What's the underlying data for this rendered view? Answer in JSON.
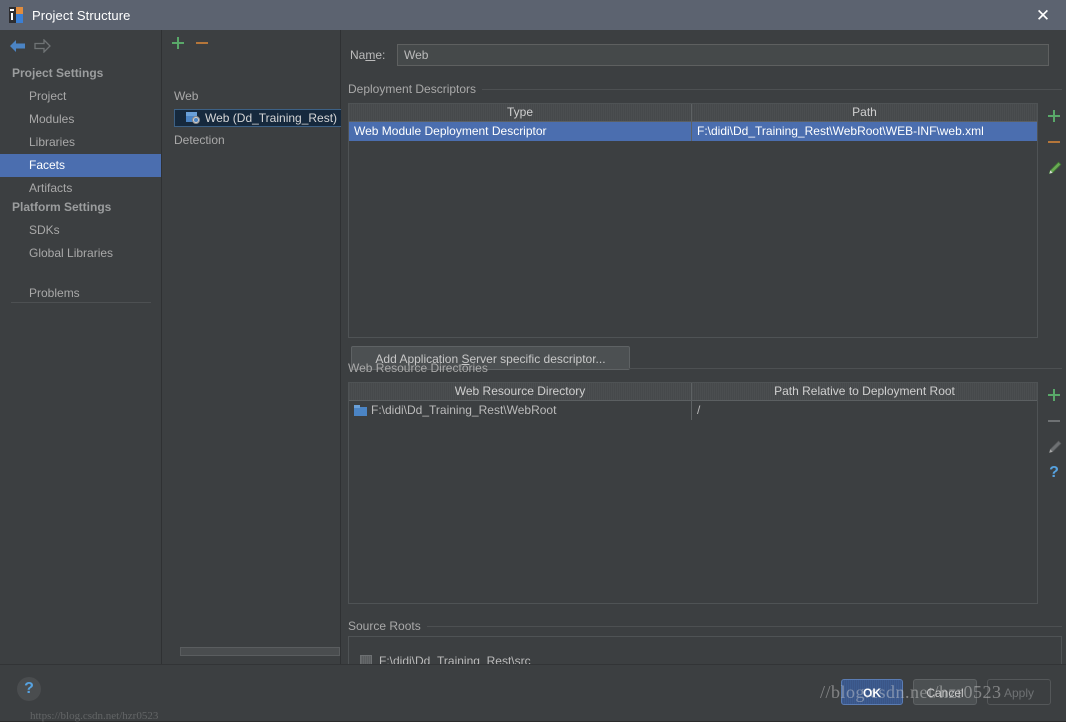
{
  "window": {
    "title": "Project Structure",
    "icon": "intellij-idea-icon",
    "close_label": "✕"
  },
  "nav": {
    "back_icon": "arrow-left-icon",
    "forward_icon": "arrow-right-icon"
  },
  "sidebar": {
    "groups": [
      {
        "label": "Project Settings"
      },
      {
        "label": "Platform Settings"
      }
    ],
    "items": [
      {
        "label": "Project",
        "selected": false
      },
      {
        "label": "Modules",
        "selected": false
      },
      {
        "label": "Libraries",
        "selected": false
      },
      {
        "label": "Facets",
        "selected": true
      },
      {
        "label": "Artifacts",
        "selected": false
      },
      {
        "label": "SDKs",
        "selected": false
      },
      {
        "label": "Global Libraries",
        "selected": false
      },
      {
        "label": "Problems",
        "selected": false
      }
    ]
  },
  "tree_panel": {
    "toolbar": {
      "add_icon": "plus-icon",
      "remove_icon": "minus-icon",
      "add_color": "#59a869",
      "remove_color": "#b5763a"
    },
    "group_web": "Web",
    "group_detection": "Detection",
    "selected_node": "Web (Dd_Training_Rest)",
    "node_icon": "web-facet-icon"
  },
  "content": {
    "name": {
      "label_before": "Na",
      "label_accel": "m",
      "label_after": "e:",
      "value": "Web"
    },
    "deployment_descriptors": {
      "section_label": "Deployment Descriptors",
      "columns": [
        "Type",
        "Path"
      ],
      "rows": [
        {
          "type": "Web Module Deployment Descriptor",
          "path": "F:\\didi\\Dd_Training_Rest\\WebRoot\\WEB-INF\\web.xml",
          "selected": true
        }
      ],
      "toolbar": [
        {
          "name": "add-descriptor-icon",
          "icon": "plus-icon",
          "color": "#59a869",
          "enabled": true
        },
        {
          "name": "remove-descriptor-icon",
          "icon": "minus-icon",
          "color": "#b5763a",
          "enabled": true
        },
        {
          "name": "edit-descriptor-icon",
          "icon": "pencil-icon",
          "color": "#59a869",
          "enabled": true
        }
      ]
    },
    "add_descriptor_button": {
      "text_before": "Add Application ",
      "text_accel": "S",
      "text_after": "erver specific descriptor..."
    },
    "web_resource_directories": {
      "section_label": "Web Resource Directories",
      "columns": [
        "Web Resource Directory",
        "Path Relative to Deployment Root"
      ],
      "rows": [
        {
          "directory": "F:\\didi\\Dd_Training_Rest\\WebRoot",
          "relative_path": "/",
          "icon": "folder-icon",
          "selected": false
        }
      ],
      "toolbar": [
        {
          "name": "add-web-resource-icon",
          "icon": "plus-icon",
          "color": "#59a869",
          "enabled": true
        },
        {
          "name": "remove-web-resource-icon",
          "icon": "minus-icon",
          "color": "#6e7173",
          "enabled": false
        },
        {
          "name": "edit-web-resource-icon",
          "icon": "pencil-icon",
          "color": "#6e7173",
          "enabled": false
        },
        {
          "name": "help-web-resource-icon",
          "icon": "question-icon",
          "color": "#56a2e0",
          "enabled": true
        }
      ]
    },
    "source_roots": {
      "section_label": "Source Roots",
      "items": [
        {
          "label": "F:\\didi\\Dd_Training_Rest\\src",
          "checked": false,
          "icon": "source-root-icon"
        }
      ]
    }
  },
  "footer": {
    "help_icon": "question-icon",
    "help_glyph": "?",
    "buttons": [
      {
        "name": "ok-button",
        "label": "OK",
        "enabled": true,
        "default": true
      },
      {
        "name": "cancel-button",
        "label": "Cancel",
        "enabled": true,
        "default": false
      },
      {
        "name": "apply-button",
        "label": "Apply",
        "enabled": false,
        "default": false
      }
    ]
  },
  "watermark": {
    "text": "//blog.csdn.net/hzr0523",
    "text_secondary": "https://blog.csdn.net/hzr0523"
  },
  "colors": {
    "accent_selection": "#4b6eaf",
    "panel_bg": "#3c3f41",
    "titlebar_bg": "#5c6370",
    "add_green": "#59a869",
    "remove_orange": "#b5763a",
    "help_blue": "#56a2e0"
  }
}
